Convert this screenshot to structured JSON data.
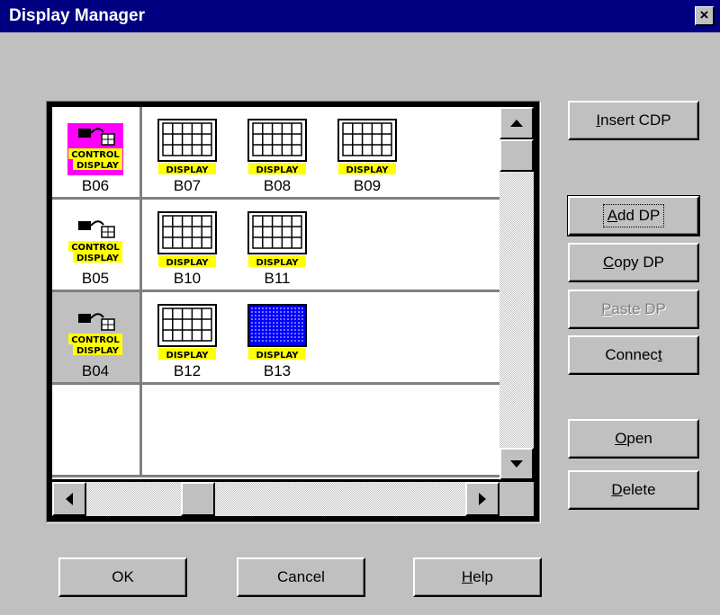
{
  "window": {
    "title": "Display Manager",
    "close_glyph": "×"
  },
  "grid": {
    "rows": [
      {
        "left": {
          "type": "control",
          "label": "B06",
          "highlight": "magenta"
        },
        "items": [
          {
            "label": "B07",
            "pattern": "grid"
          },
          {
            "label": "B08",
            "pattern": "grid"
          },
          {
            "label": "B09",
            "pattern": "grid"
          }
        ]
      },
      {
        "left": {
          "type": "control",
          "label": "B05",
          "highlight": "none"
        },
        "items": [
          {
            "label": "B10",
            "pattern": "grid"
          },
          {
            "label": "B11",
            "pattern": "grid"
          }
        ]
      },
      {
        "left": {
          "type": "control",
          "label": "B04",
          "highlight": "selected"
        },
        "items": [
          {
            "label": "B12",
            "pattern": "grid"
          },
          {
            "label": "B13",
            "pattern": "dotted-blue"
          }
        ]
      },
      {
        "left": null,
        "items": []
      }
    ],
    "icon_text": {
      "control_top": "CONTROL",
      "control_bottom": "DISPLAY",
      "display": "DISPLAY"
    }
  },
  "buttons": {
    "insert_cdp": {
      "pre": "",
      "u": "I",
      "post": "nsert CDP"
    },
    "add_dp": {
      "pre": "",
      "u": "A",
      "post": "dd DP"
    },
    "copy_dp": {
      "pre": "",
      "u": "C",
      "post": "opy DP"
    },
    "paste_dp": {
      "pre": "",
      "u": "P",
      "post": "aste DP"
    },
    "connect": {
      "pre": "Connec",
      "u": "t",
      "post": ""
    },
    "open": {
      "pre": "",
      "u": "O",
      "post": "pen"
    },
    "delete": {
      "pre": "",
      "u": "D",
      "post": "elete"
    },
    "ok": "OK",
    "cancel": "Cancel",
    "help": {
      "pre": "",
      "u": "H",
      "post": "elp"
    }
  },
  "colors": {
    "titlebar": "#000080",
    "face": "#c0c0c0",
    "magenta": "#ff00ff",
    "yellow": "#ffff00",
    "blue_dots": "#0000ff"
  }
}
